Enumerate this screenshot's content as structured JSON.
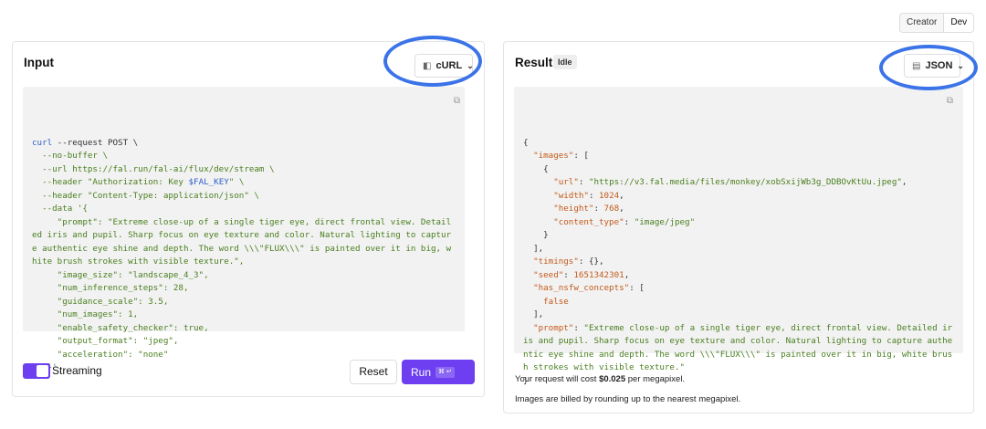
{
  "mode_toggle": {
    "creator": "Creator",
    "dev": "Dev"
  },
  "input": {
    "title": "Input",
    "format_button": {
      "label": "cURL",
      "icon": "cube-icon"
    },
    "code_lines": [
      [
        {
          "t": "cmd",
          "v": "curl"
        },
        {
          "t": "p",
          "v": " --request POST \\"
        }
      ],
      [
        {
          "t": "s",
          "v": "  --no-buffer \\"
        }
      ],
      [
        {
          "t": "s",
          "v": "  --url https://fal.run/fal-ai/flux/dev/stream \\"
        }
      ],
      [
        {
          "t": "s",
          "v": "  --header \"Authorization: Key "
        },
        {
          "t": "kw",
          "v": "$FAL_KEY"
        },
        {
          "t": "s",
          "v": "\" \\"
        }
      ],
      [
        {
          "t": "s",
          "v": "  --header \"Content-Type: application/json\" \\"
        }
      ],
      [
        {
          "t": "s",
          "v": "  --data '{"
        }
      ],
      [
        {
          "t": "s",
          "v": "     \"prompt\": \"Extreme close-up of a single tiger eye, direct frontal view. Detailed iris and pupil. Sharp focus on eye texture and color. Natural lighting to capture authentic eye shine and depth. The word \\\\\\\"FLUX\\\\\\\" is painted over it in big, white brush strokes with visible texture.\","
        }
      ],
      [
        {
          "t": "s",
          "v": "     \"image_size\": \"landscape_4_3\","
        }
      ],
      [
        {
          "t": "s",
          "v": "     \"num_inference_steps\": 28,"
        }
      ],
      [
        {
          "t": "s",
          "v": "     \"guidance_scale\": 3.5,"
        }
      ],
      [
        {
          "t": "s",
          "v": "     \"num_images\": 1,"
        }
      ],
      [
        {
          "t": "s",
          "v": "     \"enable_safety_checker\": true,"
        }
      ],
      [
        {
          "t": "s",
          "v": "     \"output_format\": \"jpeg\","
        }
      ],
      [
        {
          "t": "s",
          "v": "     \"acceleration\": \"none\""
        }
      ],
      [
        {
          "t": "s",
          "v": "   }'"
        }
      ]
    ],
    "streaming_label": "Streaming",
    "reset_label": "Reset",
    "run_label": "Run",
    "run_shortcut": "⌘ ↵"
  },
  "result": {
    "title": "Result",
    "status": "Idle",
    "format_button": {
      "label": "JSON",
      "icon": "file-code-icon"
    },
    "code_lines": [
      [
        {
          "t": "p",
          "v": "{"
        }
      ],
      [
        {
          "t": "p",
          "v": "  "
        },
        {
          "t": "k",
          "v": "\"images\""
        },
        {
          "t": "p",
          "v": ": ["
        }
      ],
      [
        {
          "t": "p",
          "v": "    {"
        }
      ],
      [
        {
          "t": "p",
          "v": "      "
        },
        {
          "t": "k",
          "v": "\"url\""
        },
        {
          "t": "p",
          "v": ": "
        },
        {
          "t": "s",
          "v": "\"https://v3.fal.media/files/monkey/xobSxijWb3g_DDBOvKtUu.jpeg\""
        },
        {
          "t": "p",
          "v": ","
        }
      ],
      [
        {
          "t": "p",
          "v": "      "
        },
        {
          "t": "k",
          "v": "\"width\""
        },
        {
          "t": "p",
          "v": ": "
        },
        {
          "t": "n",
          "v": "1024"
        },
        {
          "t": "p",
          "v": ","
        }
      ],
      [
        {
          "t": "p",
          "v": "      "
        },
        {
          "t": "k",
          "v": "\"height\""
        },
        {
          "t": "p",
          "v": ": "
        },
        {
          "t": "n",
          "v": "768"
        },
        {
          "t": "p",
          "v": ","
        }
      ],
      [
        {
          "t": "p",
          "v": "      "
        },
        {
          "t": "k",
          "v": "\"content_type\""
        },
        {
          "t": "p",
          "v": ": "
        },
        {
          "t": "s",
          "v": "\"image/jpeg\""
        }
      ],
      [
        {
          "t": "p",
          "v": "    }"
        }
      ],
      [
        {
          "t": "p",
          "v": "  ],"
        }
      ],
      [
        {
          "t": "p",
          "v": "  "
        },
        {
          "t": "k",
          "v": "\"timings\""
        },
        {
          "t": "p",
          "v": ": {},"
        }
      ],
      [
        {
          "t": "p",
          "v": "  "
        },
        {
          "t": "k",
          "v": "\"seed\""
        },
        {
          "t": "p",
          "v": ": "
        },
        {
          "t": "n",
          "v": "1651342301"
        },
        {
          "t": "p",
          "v": ","
        }
      ],
      [
        {
          "t": "p",
          "v": "  "
        },
        {
          "t": "k",
          "v": "\"has_nsfw_concepts\""
        },
        {
          "t": "p",
          "v": ": ["
        }
      ],
      [
        {
          "t": "p",
          "v": "    "
        },
        {
          "t": "n",
          "v": "false"
        }
      ],
      [
        {
          "t": "p",
          "v": "  ],"
        }
      ],
      [
        {
          "t": "p",
          "v": "  "
        },
        {
          "t": "k",
          "v": "\"prompt\""
        },
        {
          "t": "p",
          "v": ": "
        },
        {
          "t": "s",
          "v": "\"Extreme close-up of a single tiger eye, direct frontal view. Detailed iris and pupil. Sharp focus on eye texture and color. Natural lighting to capture authentic eye shine and depth. The word \\\\\\\"FLUX\\\\\\\" is painted over it in big, white brush strokes with visible texture.\""
        }
      ],
      [
        {
          "t": "p",
          "v": "}"
        }
      ]
    ],
    "cost_prefix": "Your request will cost ",
    "cost_value": "$0.025",
    "cost_suffix": " per megapixel.",
    "billing_note": "Images are billed by rounding up to the nearest megapixel."
  },
  "colors": {
    "accent": "#6d3ff0",
    "highlight_ring": "#3b73e8"
  }
}
